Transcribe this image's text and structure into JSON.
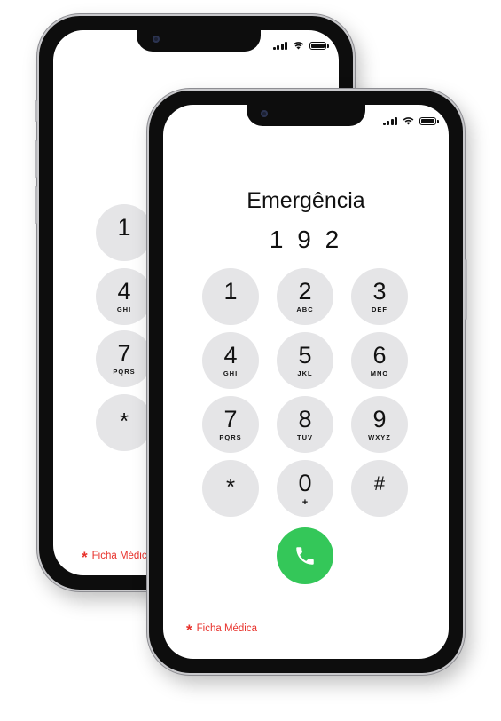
{
  "status_bar": {
    "signal_icon": "cellular-signal-icon",
    "wifi_icon": "wifi-icon",
    "battery_icon": "battery-icon"
  },
  "dialer": {
    "label": "Emergência",
    "number": "1 9 2",
    "keys": [
      {
        "digit": "1",
        "letters": ""
      },
      {
        "digit": "2",
        "letters": "ABC"
      },
      {
        "digit": "3",
        "letters": "DEF"
      },
      {
        "digit": "4",
        "letters": "GHI"
      },
      {
        "digit": "5",
        "letters": "JKL"
      },
      {
        "digit": "6",
        "letters": "MNO"
      },
      {
        "digit": "7",
        "letters": "PQRS"
      },
      {
        "digit": "8",
        "letters": "TUV"
      },
      {
        "digit": "9",
        "letters": "WXYZ"
      },
      {
        "digit": "*",
        "letters": ""
      },
      {
        "digit": "0",
        "letters": "+"
      },
      {
        "digit": "#",
        "letters": ""
      }
    ],
    "call_icon": "phone-handset-icon",
    "call_color": "#34c759",
    "medical_id": {
      "icon": "asterisk",
      "label": "Ficha Médica",
      "color": "#e8322c"
    }
  }
}
